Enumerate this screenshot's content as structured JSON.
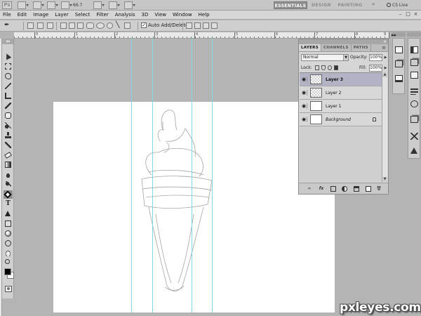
{
  "app": {
    "logo": "Ps",
    "zoom": "66.7",
    "workspaces": [
      {
        "label": "ESSENTIALS",
        "active": true
      },
      {
        "label": "DESIGN",
        "active": false
      },
      {
        "label": "PAINTING",
        "active": false
      }
    ],
    "more": "»",
    "cs_live": "CS Live"
  },
  "menu": [
    "File",
    "Edit",
    "Image",
    "Layer",
    "Select",
    "Filter",
    "Analysis",
    "3D",
    "View",
    "Window",
    "Help"
  ],
  "window_controls": [
    "–",
    "□",
    "×"
  ],
  "options_bar": {
    "auto_add_delete_label": "Auto Add/Delete",
    "auto_add_delete_checked": true
  },
  "ruler": {
    "numbers": [
      "0",
      "1",
      "2",
      "3",
      "4",
      "5",
      "6",
      "7",
      "8",
      "9"
    ]
  },
  "tools_panel": {
    "collapse": "◂◂",
    "tools": [
      "move-tool",
      "marquee-tool",
      "lasso-tool",
      "quick-selection-tool",
      "crop-tool",
      "eyedropper-tool",
      "spot-healing-tool",
      "brush-tool",
      "clone-stamp-tool",
      "history-brush-tool",
      "eraser-tool",
      "gradient-tool",
      "blur-tool",
      "dodge-tool",
      "pen-tool",
      "type-tool",
      "path-selection-tool",
      "shape-tool",
      "3d-rotate-tool",
      "3d-camera-tool",
      "hand-tool",
      "zoom-tool"
    ],
    "type_glyph": "T",
    "foreground_color": "#000000",
    "background_color": "#ffffff"
  },
  "layers_panel": {
    "collapse": "◂◂",
    "close": "×",
    "tabs": [
      {
        "label": "LAYERS",
        "active": true
      },
      {
        "label": "CHANNELS",
        "active": false
      },
      {
        "label": "PATHS",
        "active": false
      }
    ],
    "menu_icon": "≡",
    "blend_mode": "Normal",
    "opacity_label": "Opacity:",
    "opacity_value": "100%",
    "lock_label": "Lock:",
    "fill_label": "Fill:",
    "fill_value": "100%",
    "layers": [
      {
        "name": "Layer 3",
        "selected": true,
        "transparent": true,
        "locked": false
      },
      {
        "name": "Layer 2",
        "selected": false,
        "transparent": true,
        "locked": false
      },
      {
        "name": "Layer 1",
        "selected": false,
        "transparent": false,
        "locked": false
      },
      {
        "name": "Background",
        "selected": false,
        "transparent": false,
        "locked": true
      }
    ],
    "footer_icons": [
      "link-icon",
      "fx-icon",
      "mask-icon",
      "adjustment-icon",
      "folder-icon",
      "new-layer-icon",
      "trash-icon"
    ],
    "fx_glyph": "fx"
  },
  "dock": {
    "collapse": "▸▸"
  },
  "watermark": "pxleyes.com",
  "colors": {
    "guide": "#7fd6e6",
    "selected_layer": "#b2b3c4",
    "canvas": "#ffffff",
    "workspace": "#b4b4b4"
  }
}
